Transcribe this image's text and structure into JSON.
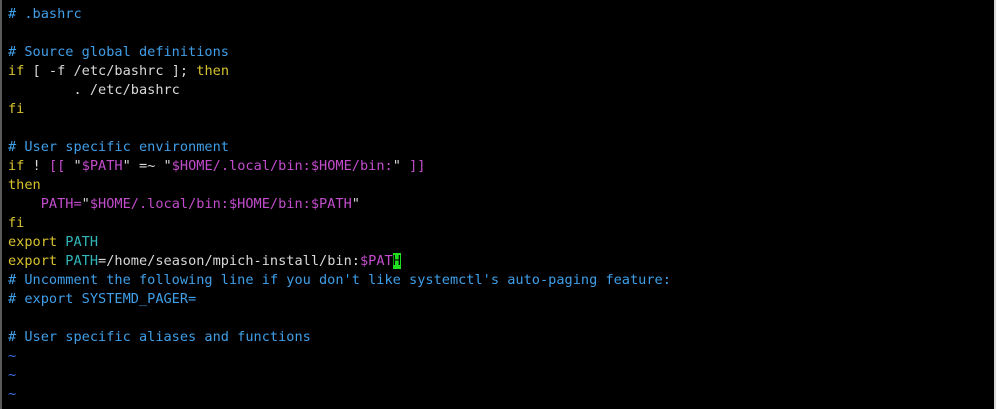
{
  "editor": {
    "lines": [
      [
        {
          "t": "# .bashrc",
          "c": "comment"
        }
      ],
      [],
      [
        {
          "t": "# Source global definitions",
          "c": "comment"
        }
      ],
      [
        {
          "t": "if",
          "c": "keyword"
        },
        {
          "t": " [ -f ",
          "c": "plain"
        },
        {
          "t": "/etc/bashrc",
          "c": "plain"
        },
        {
          "t": " ]; ",
          "c": "plain"
        },
        {
          "t": "then",
          "c": "keyword"
        }
      ],
      [
        {
          "t": "        . /etc/bashrc",
          "c": "plain"
        }
      ],
      [
        {
          "t": "fi",
          "c": "keyword"
        }
      ],
      [],
      [
        {
          "t": "# User specific environment",
          "c": "comment"
        }
      ],
      [
        {
          "t": "if",
          "c": "keyword"
        },
        {
          "t": " ! ",
          "c": "plain"
        },
        {
          "t": "[[ ",
          "c": "string"
        },
        {
          "t": "\"",
          "c": "plain"
        },
        {
          "t": "$PATH",
          "c": "var"
        },
        {
          "t": "\"",
          "c": "plain"
        },
        {
          "t": " =~ ",
          "c": "plain"
        },
        {
          "t": "\"",
          "c": "plain"
        },
        {
          "t": "$HOME",
          "c": "var"
        },
        {
          "t": "/.local/bin:",
          "c": "string"
        },
        {
          "t": "$HOME",
          "c": "var"
        },
        {
          "t": "/bin:",
          "c": "string"
        },
        {
          "t": "\"",
          "c": "plain"
        },
        {
          "t": " ]]",
          "c": "string"
        }
      ],
      [
        {
          "t": "then",
          "c": "keyword"
        }
      ],
      [
        {
          "t": "    ",
          "c": "plain"
        },
        {
          "t": "PATH=",
          "c": "string"
        },
        {
          "t": "\"",
          "c": "plain"
        },
        {
          "t": "$HOME",
          "c": "var"
        },
        {
          "t": "/.local/bin:",
          "c": "string"
        },
        {
          "t": "$HOME",
          "c": "var"
        },
        {
          "t": "/bin:",
          "c": "string"
        },
        {
          "t": "$PATH",
          "c": "var"
        },
        {
          "t": "\"",
          "c": "plain"
        }
      ],
      [
        {
          "t": "fi",
          "c": "keyword"
        }
      ],
      [
        {
          "t": "export",
          "c": "keyword"
        },
        {
          "t": " ",
          "c": "plain"
        },
        {
          "t": "PATH",
          "c": "ident"
        }
      ],
      [
        {
          "t": "export",
          "c": "keyword"
        },
        {
          "t": " ",
          "c": "plain"
        },
        {
          "t": "PATH",
          "c": "ident"
        },
        {
          "t": "=/home/season/mpich-install/bin:",
          "c": "plain"
        },
        {
          "t": "$PAT",
          "c": "var"
        },
        {
          "t": "H",
          "c": "cursor"
        }
      ],
      [
        {
          "t": "# Uncomment the following line if you don't like systemctl's auto-paging feature:",
          "c": "comment"
        }
      ],
      [
        {
          "t": "# export SYSTEMD_PAGER=",
          "c": "comment"
        }
      ],
      [],
      [
        {
          "t": "# User specific aliases and functions",
          "c": "comment"
        }
      ],
      [
        {
          "t": "~",
          "c": "tilde"
        }
      ],
      [
        {
          "t": "~",
          "c": "tilde"
        }
      ],
      [
        {
          "t": "~",
          "c": "tilde"
        }
      ]
    ]
  },
  "colors": {
    "background": "#000000",
    "comment": "#3f9fe8",
    "keyword": "#d6c22e",
    "string": "#c24ccc",
    "identifier": "#31b7ba",
    "cursor": "#20e020"
  }
}
